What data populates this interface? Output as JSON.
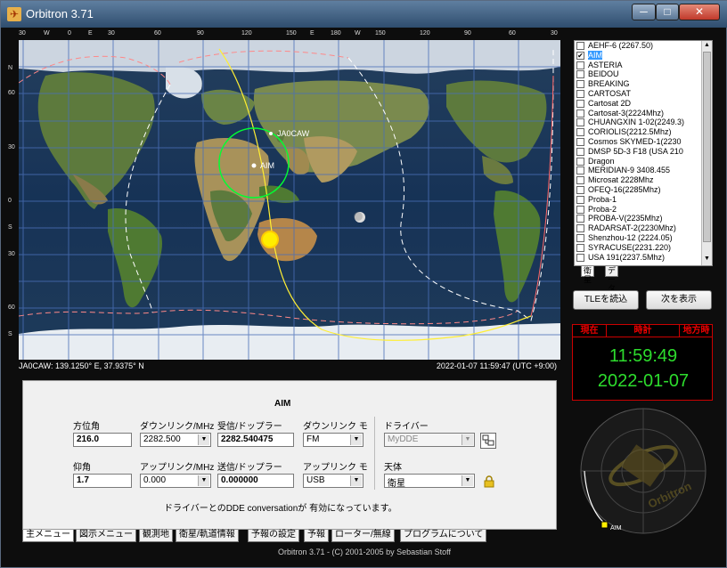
{
  "app": {
    "title": "Orbitron 3.71",
    "minimize": "─",
    "maximize": "□",
    "close": "✕"
  },
  "map": {
    "lon_ticks": [
      "30",
      "W",
      "0",
      "E",
      "30",
      "60",
      "90",
      "120",
      "150",
      "E",
      "180",
      "W",
      "150",
      "120",
      "90",
      "60",
      "30"
    ],
    "lat_ticks": [
      "N",
      "60",
      "30",
      "0",
      "S",
      "30",
      "60",
      "S"
    ],
    "labels": {
      "station": "JA0CAW",
      "satellite": "AIM"
    },
    "status_left": "JA0CAW: 139.1250° E, 37.9375° N",
    "status_right": "2022-01-07 11:59:47 (UTC +9:00)"
  },
  "panel": {
    "title": "AIM",
    "azimuth_label": "方位角",
    "azimuth_value": "216.0",
    "elevation_label": "仰角",
    "elevation_value": "1.7",
    "downlink_label": "ダウンリンク/MHz",
    "downlink_value": "2282.500",
    "uplink_label": "アップリンク/MHz",
    "uplink_value": "0.000",
    "rx_doppler_label": "受信/ドップラー",
    "rx_doppler_value": "2282.540475",
    "tx_doppler_label": "送信/ドップラー",
    "tx_doppler_value": "0.000000",
    "downlink_mode_label": "ダウンリンク モ",
    "downlink_mode_value": "FM",
    "uplink_mode_label": "アップリンク モ",
    "uplink_mode_value": "USB",
    "driver_label": "ドライバー",
    "driver_value": "MyDDE",
    "body_label": "天体",
    "body_value": "衛星",
    "status": "ドライバーとのDDE conversationが 有効になっています。"
  },
  "tabs": [
    "主メニュー",
    "図示メニュー",
    "観測地",
    "衛星/軌道情報",
    "予報の設定",
    "予報",
    "ローター/無線",
    "プログラムについて"
  ],
  "satellites": [
    {
      "name": "AEHF-6 (2267.50)",
      "checked": false,
      "selected": false
    },
    {
      "name": "AIM",
      "checked": true,
      "selected": true
    },
    {
      "name": "ASTERIA",
      "checked": false,
      "selected": false
    },
    {
      "name": "BEIDOU",
      "checked": false,
      "selected": false
    },
    {
      "name": "BREAKING",
      "checked": false,
      "selected": false
    },
    {
      "name": "CARTOSAT",
      "checked": false,
      "selected": false
    },
    {
      "name": "Cartosat 2D",
      "checked": false,
      "selected": false
    },
    {
      "name": "Cartosat-3(2224Mhz)",
      "checked": false,
      "selected": false
    },
    {
      "name": "CHUANGXIN 1-02(2249.3)",
      "checked": false,
      "selected": false
    },
    {
      "name": "CORIOLIS(2212.5Mhz)",
      "checked": false,
      "selected": false
    },
    {
      "name": "Cosmos SKYMED-1(2230",
      "checked": false,
      "selected": false
    },
    {
      "name": "DMSP 5D-3 F18 (USA 210",
      "checked": false,
      "selected": false
    },
    {
      "name": "Dragon",
      "checked": false,
      "selected": false
    },
    {
      "name": "MERIDIAN-9  3408.455",
      "checked": false,
      "selected": false
    },
    {
      "name": "Microsat 2228Mhz",
      "checked": false,
      "selected": false
    },
    {
      "name": "OFEQ-16(2285Mhz)",
      "checked": false,
      "selected": false
    },
    {
      "name": "Proba-1",
      "checked": false,
      "selected": false
    },
    {
      "name": "Proba-2",
      "checked": false,
      "selected": false
    },
    {
      "name": "PROBA-V(2235Mhz)",
      "checked": false,
      "selected": false
    },
    {
      "name": "RADARSAT-2(2230Mhz)",
      "checked": false,
      "selected": false
    },
    {
      "name": "Shenzhou-12 (2224.05)",
      "checked": false,
      "selected": false
    },
    {
      "name": "SYRACUSE(2231.220)",
      "checked": false,
      "selected": false
    },
    {
      "name": "USA 191(2237.5Mhz)",
      "checked": false,
      "selected": false
    }
  ],
  "list_tabs": [
    "衛星",
    "データ"
  ],
  "buttons": {
    "load_tle": "TLEを読込",
    "show_next": "次を表示"
  },
  "clock": {
    "h_current": "現在",
    "h_clock": "時計",
    "h_local": "地方時",
    "time": "11:59:49",
    "date": "2022-01-07"
  },
  "radar": {
    "label": "AIM"
  },
  "footer": "Orbitron 3.71 - (C) 2001-2005 by Sebastian Stoff"
}
